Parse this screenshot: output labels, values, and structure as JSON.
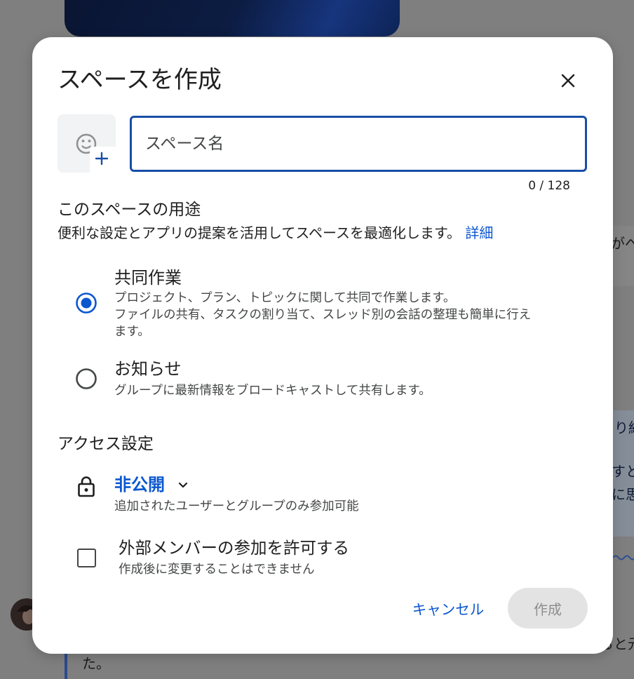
{
  "dialog": {
    "title": "スペースを作成",
    "name_input": {
      "placeholder": "スペース名",
      "counter": "0 / 128"
    },
    "purpose": {
      "heading": "このスペースの用途",
      "description": "便利な設定とアプリの提案を活用してスペースを最適化します。",
      "learn_more": "詳細",
      "options": [
        {
          "title": "共同作業",
          "desc": [
            "プロジェクト、プラン、トピックに関して共同で作業します。",
            "ファイルの共有、タスクの割り当て、スレッド別の会話の整理も簡単に行えます。"
          ],
          "selected": true
        },
        {
          "title": "お知らせ",
          "desc": [
            "グループに最新情報をブロードキャストして共有します。"
          ],
          "selected": false
        }
      ]
    },
    "access": {
      "heading": "アクセス設定",
      "level": "非公開",
      "level_description": "追加されたユーザーとグループのみ参加可能",
      "external": {
        "label": "外部メンバーの参加を許可する",
        "note": "作成後に変更することはできません",
        "checked": false
      }
    },
    "actions": {
      "cancel": "キャンセル",
      "create": "作成",
      "create_enabled": false
    }
  },
  "background": {
    "fragments": [
      "がへ",
      "り紹",
      "すと",
      "に思",
      "ると元",
      "た。"
    ]
  },
  "icons": {
    "close": "close-icon",
    "emoji": "add-reaction-icon",
    "add": "plus-icon",
    "radio_on": "radio-selected-icon",
    "radio_off": "radio-unselected-icon",
    "lock": "lock-icon",
    "dropdown": "chevron-down-icon"
  },
  "colors": {
    "primary": "#0b57d0",
    "input_border": "#174ea6",
    "text": "#1f1f1f",
    "secondary_text": "#444746",
    "disabled_bg": "#e3e3e3",
    "disabled_text": "#8e8e8e",
    "overlay": "#7f7f7f"
  }
}
